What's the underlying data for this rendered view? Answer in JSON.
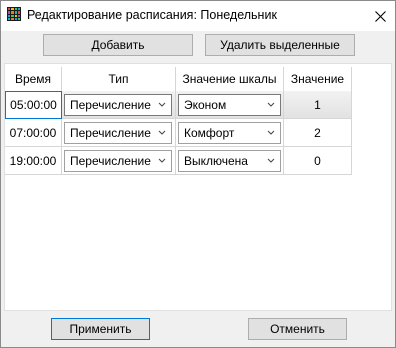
{
  "window": {
    "title": "Редактирование расписания: Понедельник",
    "icon": "app-grid-icon",
    "close_icon": "close-icon"
  },
  "toolbar": {
    "add_label": "Добавить",
    "delete_selected_label": "Удалить выделенные"
  },
  "grid": {
    "columns": [
      "Время",
      "Тип",
      "Значение шкалы",
      "Значение"
    ],
    "rows": [
      {
        "time": "05:00:00",
        "type": "Перечисление",
        "scale_value": "Эконом",
        "value": "1",
        "selected": true
      },
      {
        "time": "07:00:00",
        "type": "Перечисление",
        "scale_value": "Комфорт",
        "value": "2",
        "selected": false
      },
      {
        "time": "19:00:00",
        "type": "Перечисление",
        "scale_value": "Выключена",
        "value": "0",
        "selected": false
      }
    ]
  },
  "footer": {
    "apply_label": "Применить",
    "cancel_label": "Отменить"
  },
  "colors": {
    "focus_border": "#0078d7",
    "button_bg": "#e1e1e1",
    "window_bg": "#f0f0f0"
  }
}
